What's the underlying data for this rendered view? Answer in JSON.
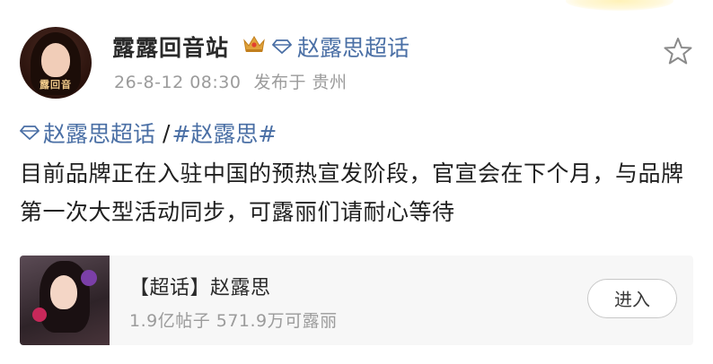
{
  "post": {
    "author": "露露回音站",
    "header_topic": "赵露思超话",
    "timestamp": "26-8-12 08:30",
    "location": "发布于 贵州",
    "avatar_text": "露回音",
    "tags": {
      "super_topic": "赵露思超话",
      "separator": "/",
      "hashtag": "#赵露思#"
    },
    "text": "目前品牌正在入驻中国的预热宣发阶段，官宣会在下个月，与品牌第一次大型活动同步，可露丽们请耐心等待"
  },
  "card": {
    "title": "【超话】赵露思",
    "stats": "1.9亿帖子 571.9万可露丽",
    "enter_label": "进入"
  },
  "icons": {
    "crown": "crown-icon",
    "diamond": "diamond-icon",
    "star": "star-icon"
  },
  "colors": {
    "link": "#4a6fa5",
    "meta": "#9b9b9b",
    "card_bg": "#f7f7f7",
    "crown": "#e0a23a"
  }
}
